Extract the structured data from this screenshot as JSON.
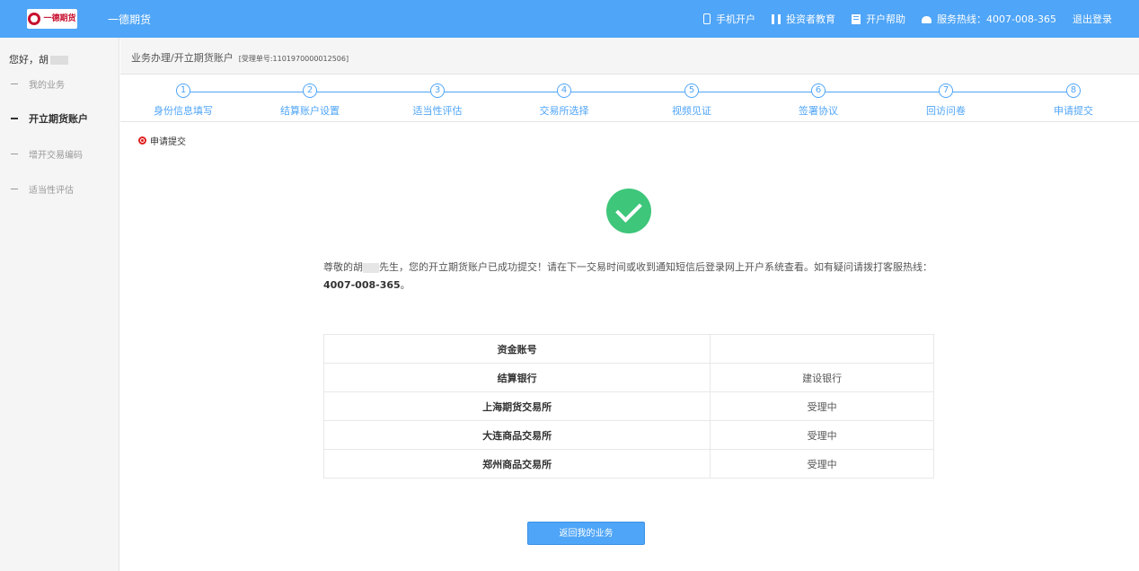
{
  "header": {
    "logo_text": "一德期货",
    "app_title": "一德期货",
    "nav": [
      {
        "icon": "phone-icon",
        "label": "手机开户"
      },
      {
        "icon": "book-icon",
        "label": "投资者教育"
      },
      {
        "icon": "document-icon",
        "label": "开户帮助"
      },
      {
        "icon": "telephone-icon",
        "label": "服务热线：4007-008-365"
      },
      {
        "label": "退出登录"
      }
    ]
  },
  "sidebar": {
    "greeting": "您好，胡",
    "items": [
      {
        "label": "我的业务",
        "active": false
      },
      {
        "label": "开立期货账户",
        "active": true
      },
      {
        "label": "增开交易编码",
        "active": false
      },
      {
        "label": "适当性评估",
        "active": false
      }
    ]
  },
  "breadcrumb": {
    "path": "业务办理/开立期货账户",
    "order": "[受理单号:1101970000012506]"
  },
  "steps": [
    {
      "num": "1",
      "label": "身份信息填写"
    },
    {
      "num": "2",
      "label": "结算账户设置"
    },
    {
      "num": "3",
      "label": "适当性评估"
    },
    {
      "num": "4",
      "label": "交易所选择"
    },
    {
      "num": "5",
      "label": "视频见证"
    },
    {
      "num": "6",
      "label": "签署协议"
    },
    {
      "num": "7",
      "label": "回访问卷"
    },
    {
      "num": "8",
      "label": "申请提交"
    }
  ],
  "main": {
    "section_title": "申请提交",
    "message_prefix": "尊敬的胡",
    "message_body": "先生，您的开立期货账户已成功提交！请在下一交易时间或收到通知短信后登录网上开户系统查看。如有疑问请拨打客服热线：",
    "hotline": "4007-008-365",
    "message_suffix": "。",
    "table": [
      {
        "key": "资金账号",
        "value": ""
      },
      {
        "key": "结算银行",
        "value": "建设银行"
      },
      {
        "key": "上海期货交易所",
        "value": "受理中"
      },
      {
        "key": "大连商品交易所",
        "value": "受理中"
      },
      {
        "key": "郑州商品交易所",
        "value": "受理中"
      }
    ],
    "back_button": "返回我的业务"
  },
  "colors": {
    "primary": "#4fa5f7",
    "success": "#3ec67a",
    "alert": "#e02020"
  }
}
